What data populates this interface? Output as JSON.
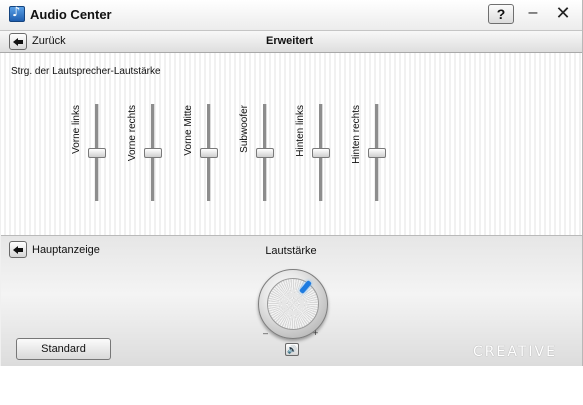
{
  "window": {
    "title": "Audio Center",
    "help_label": "?",
    "minimize_label": "–",
    "close_label": "✕"
  },
  "nav": {
    "back_label": "Zurück",
    "section_title": "Erweitert"
  },
  "speaker_panel": {
    "title": "Strg. der Lautsprecher-Lautstärke",
    "channels": [
      {
        "label": "Vorne links",
        "level": 0.5
      },
      {
        "label": "Vorne rechts",
        "level": 0.5
      },
      {
        "label": "Vorne Mitte",
        "level": 0.5
      },
      {
        "label": "Subwoofer",
        "level": 0.5
      },
      {
        "label": "Hinten links",
        "level": 0.5
      },
      {
        "label": "Hinten rechts",
        "level": 0.5
      }
    ]
  },
  "bottom": {
    "main_display_label": "Hauptanzeige",
    "volume_label": "Lautstärke",
    "volume_min": "–",
    "volume_max": "+",
    "mute_icon": "🔊",
    "standard_label": "Standard",
    "brand": "CREATIVE",
    "accent": "#1e7be0"
  }
}
